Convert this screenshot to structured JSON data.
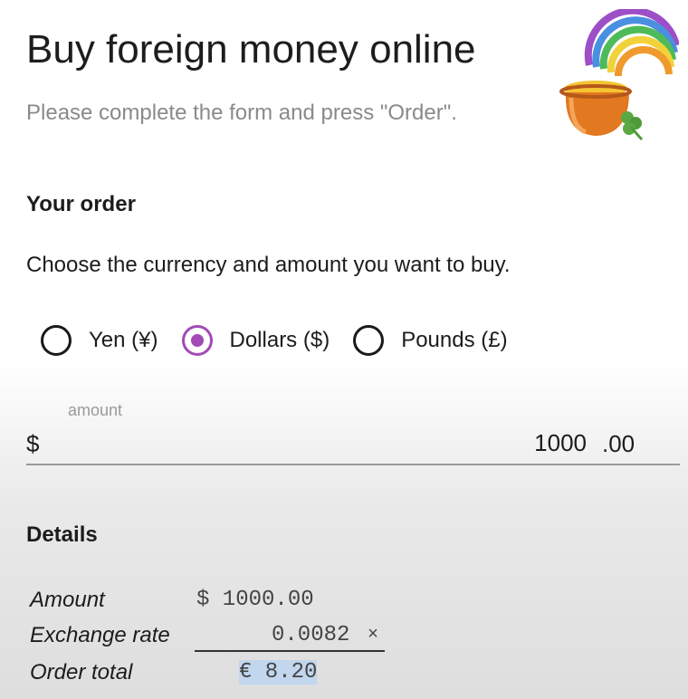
{
  "header": {
    "title": "Buy foreign money online",
    "subtitle": "Please complete the form and press \"Order\"."
  },
  "logo": {
    "icon": "rainbow-pot-of-gold-icon"
  },
  "order_section": {
    "heading": "Your order",
    "instruction": "Choose the currency and amount you want to buy.",
    "currency_options": [
      {
        "label": "Yen (¥)",
        "checked": false
      },
      {
        "label": "Dollars ($)",
        "checked": true
      },
      {
        "label": "Pounds (£)",
        "checked": false
      }
    ],
    "accent_color": "#a24ab6"
  },
  "amount_field": {
    "label": "amount",
    "prefix": "$",
    "value": "1000",
    "cents": ".00"
  },
  "details_section": {
    "heading": "Details",
    "amount_label": "Amount",
    "amount_value": "$ 1000.00",
    "rate_label": "Exchange rate",
    "rate_value": "0.0082",
    "rate_operator": "×",
    "total_label": "Order total",
    "total_value": "€ 8.20"
  }
}
